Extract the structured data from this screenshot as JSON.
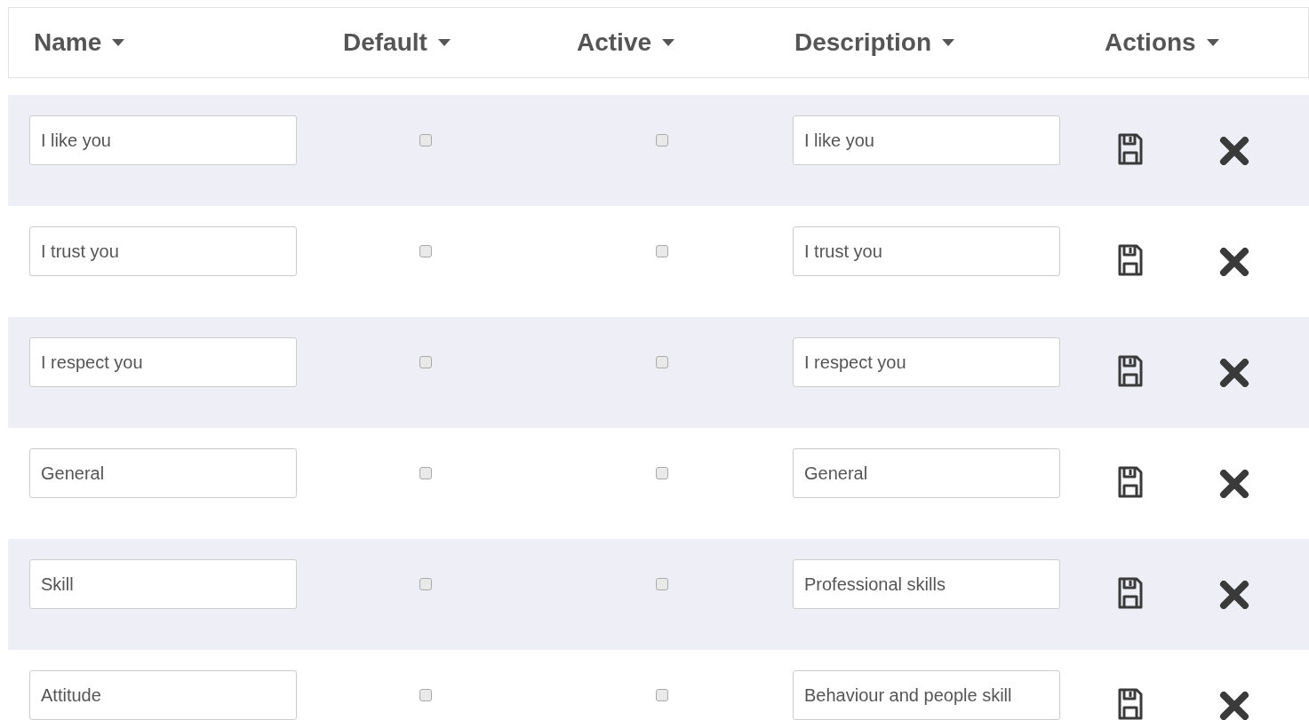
{
  "table": {
    "columns": [
      "Name",
      "Default",
      "Active",
      "Description",
      "Actions"
    ],
    "rows": [
      {
        "name": "I like you",
        "default": false,
        "active": false,
        "description": "I like you"
      },
      {
        "name": "I trust you",
        "default": false,
        "active": false,
        "description": "I trust you"
      },
      {
        "name": "I respect you",
        "default": false,
        "active": false,
        "description": "I respect you"
      },
      {
        "name": "General",
        "default": false,
        "active": false,
        "description": "General"
      },
      {
        "name": "Skill",
        "default": false,
        "active": false,
        "description": "Professional skills"
      },
      {
        "name": "Attitude",
        "default": false,
        "active": false,
        "description": "Behaviour and people skill"
      }
    ]
  }
}
